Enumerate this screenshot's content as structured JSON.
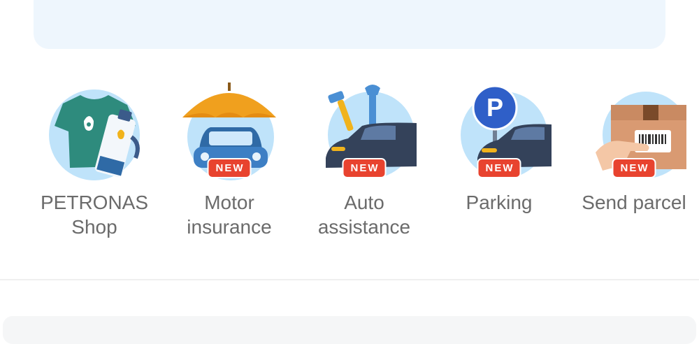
{
  "services": [
    {
      "id": "petronas-shop",
      "label_line1": "PETRONAS",
      "label_line2": "Shop",
      "badge": "",
      "icon": "shirt-oil-icon"
    },
    {
      "id": "motor-insurance",
      "label_line1": "Motor",
      "label_line2": "insurance",
      "badge": "NEW",
      "icon": "umbrella-car-icon"
    },
    {
      "id": "auto-assistance",
      "label_line1": "Auto",
      "label_line2": "assistance",
      "badge": "NEW",
      "icon": "tools-car-icon"
    },
    {
      "id": "parking",
      "label_line1": "Parking",
      "label_line2": "",
      "badge": "NEW",
      "icon": "parking-car-icon"
    },
    {
      "id": "send-parcel",
      "label_line1": "Send parcel",
      "label_line2": "",
      "badge": "NEW",
      "icon": "parcel-icon"
    }
  ],
  "colors": {
    "badge": "#e8432f",
    "label": "#6b6b6b",
    "icon_circle": "#bfe3fa",
    "top_card": "#eef6fd"
  }
}
